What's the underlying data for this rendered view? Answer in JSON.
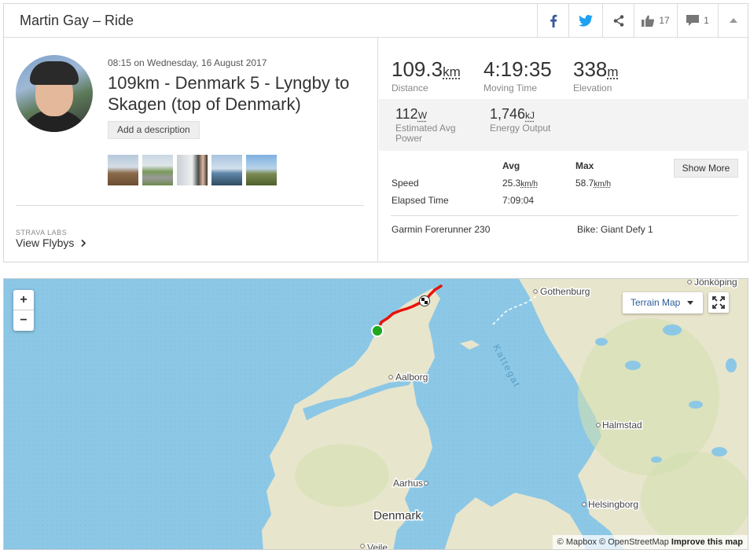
{
  "header": {
    "title": "Martin Gay – Ride",
    "likes": "17",
    "comments": "1"
  },
  "activity": {
    "datetime": "08:15 on Wednesday, 16 August 2017",
    "title": "109km - Denmark 5 - Lyngby to Skagen (top of Denmark)",
    "add_description": "Add a description",
    "labs_label": "STRAVA LABS",
    "flybys_label": "View Flybys"
  },
  "stats": {
    "distance": {
      "value": "109.3",
      "unit": "km",
      "label": "Distance"
    },
    "moving_time": {
      "value": "4:19:35",
      "label": "Moving Time"
    },
    "elevation": {
      "value": "338",
      "unit": "m",
      "label": "Elevation"
    },
    "power": {
      "value": "112",
      "unit": "W",
      "label": "Estimated Avg Power"
    },
    "energy": {
      "value": "1,746",
      "unit": "kJ",
      "label": "Energy Output"
    }
  },
  "table": {
    "col_avg": "Avg",
    "col_max": "Max",
    "show_more": "Show More",
    "speed_label": "Speed",
    "speed_avg": "25.3",
    "speed_max": "58.7",
    "speed_unit": "km/h",
    "elapsed_label": "Elapsed Time",
    "elapsed_value": "7:09:04",
    "device": "Garmin Forerunner 230",
    "bike": "Bike: Giant Defy 1"
  },
  "map": {
    "zoom_in": "+",
    "zoom_out": "−",
    "layer": "Terrain Map",
    "places": {
      "jonkoping": "Jönköping",
      "gothenburg": "Gothenburg",
      "aalborg": "Aalborg",
      "kattegat": "Kattegat",
      "halmstad": "Halmstad",
      "aarhus": "Aarhus",
      "denmark": "Denmark",
      "helsingborg": "Helsingborg",
      "vejle": "Vejle"
    },
    "attribution_mapbox": "© Mapbox",
    "attribution_osm": "© OpenStreetMap",
    "attribution_improve": "Improve this map"
  },
  "colors": {
    "water": "#8cc8e6",
    "land": "#e9e6cf",
    "route": "#e8130a",
    "start": "#1fa81f"
  }
}
